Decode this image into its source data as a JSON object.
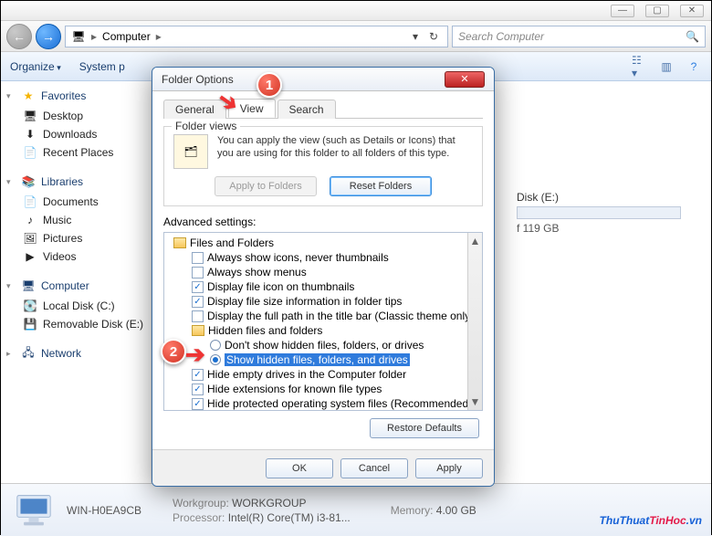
{
  "titlebar": {
    "min": "—",
    "max": "▢",
    "close": "✕"
  },
  "nav": {
    "breadcrumb": "Computer",
    "sep": "▸",
    "search_placeholder": "Search Computer"
  },
  "toolbar": {
    "organize": "Organize",
    "systemp": "System p"
  },
  "sidebar": {
    "favorites": {
      "label": "Favorites",
      "items": [
        "Desktop",
        "Downloads",
        "Recent Places"
      ]
    },
    "libraries": {
      "label": "Libraries",
      "items": [
        "Documents",
        "Music",
        "Pictures",
        "Videos"
      ]
    },
    "computer": {
      "label": "Computer",
      "items": [
        "Local Disk (C:)",
        "Removable Disk (E:)"
      ]
    },
    "network": {
      "label": "Network"
    }
  },
  "content": {
    "drive_name": "Disk (E:)",
    "drive_sub": "f 119 GB"
  },
  "dialog": {
    "title": "Folder Options",
    "close": "✕",
    "tabs": [
      "General",
      "View",
      "Search"
    ],
    "active_tab": 1,
    "folder_views": {
      "legend": "Folder views",
      "text": "You can apply the view (such as Details or Icons) that you are using for this folder to all folders of this type.",
      "apply": "Apply to Folders",
      "reset": "Reset Folders"
    },
    "advanced_label": "Advanced settings:",
    "tree": {
      "root": "Files and Folders",
      "items": [
        {
          "checked": false,
          "label": "Always show icons, never thumbnails"
        },
        {
          "checked": false,
          "label": "Always show menus"
        },
        {
          "checked": true,
          "label": "Display file icon on thumbnails"
        },
        {
          "checked": true,
          "label": "Display file size information in folder tips"
        },
        {
          "checked": false,
          "label": "Display the full path in the title bar (Classic theme only)"
        }
      ],
      "hidden_group": "Hidden files and folders",
      "radios": [
        {
          "selected": false,
          "label": "Don't show hidden files, folders, or drives"
        },
        {
          "selected": true,
          "label": "Show hidden files, folders, and drives"
        }
      ],
      "items2": [
        {
          "checked": true,
          "label": "Hide empty drives in the Computer folder"
        },
        {
          "checked": true,
          "label": "Hide extensions for known file types"
        },
        {
          "checked": true,
          "label": "Hide protected operating system files (Recommended)"
        }
      ]
    },
    "restore": "Restore Defaults",
    "buttons": {
      "ok": "OK",
      "cancel": "Cancel",
      "apply": "Apply"
    }
  },
  "callouts": {
    "one": "1",
    "two": "2"
  },
  "status": {
    "name": "WIN-H0EA9CB",
    "wg_lbl": "Workgroup:",
    "wg_val": "WORKGROUP",
    "mem_lbl": "Memory:",
    "mem_val": "4.00 GB",
    "proc_lbl": "Processor:",
    "proc_val": "Intel(R) Core(TM) i3-81..."
  },
  "watermark": {
    "a": "ThuThuat",
    "b": "TinHoc",
    "c": ".vn"
  }
}
